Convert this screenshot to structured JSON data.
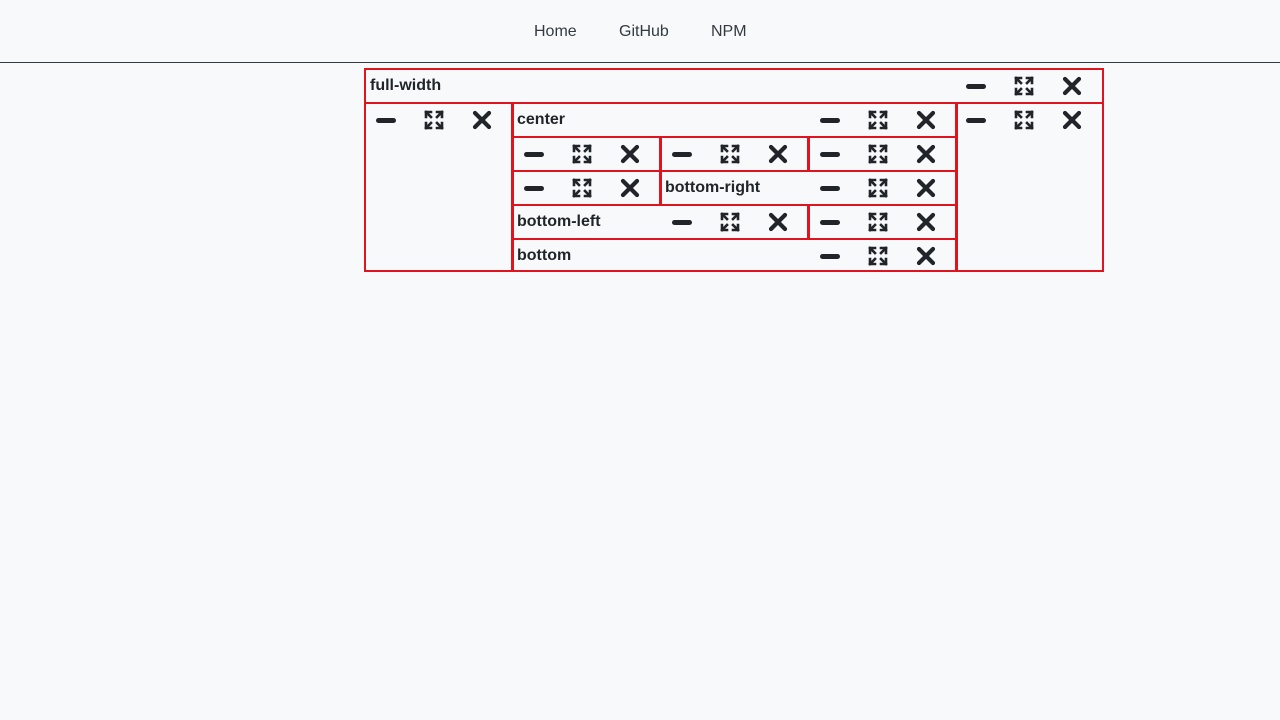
{
  "nav": {
    "links": [
      "Home",
      "GitHub",
      "NPM"
    ]
  },
  "panels": {
    "full_width": "full-width",
    "center": "center",
    "bottom_right": "bottom-right",
    "bottom_left": "bottom-left",
    "bottom": "bottom"
  },
  "icons": {
    "minimize": "minus-icon",
    "maximize": "expand-icon",
    "close": "close-icon"
  },
  "colors": {
    "panel_border": "#e0141e",
    "icon": "#212529",
    "background": "#f8f9fa"
  }
}
